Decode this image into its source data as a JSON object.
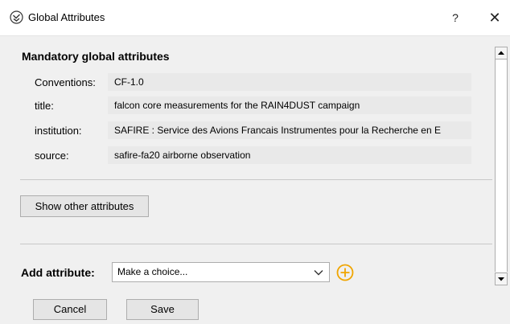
{
  "window": {
    "title": "Global Attributes",
    "help": "?",
    "close": "✕"
  },
  "mandatory": {
    "heading": "Mandatory global attributes",
    "rows": [
      {
        "label": "Conventions:",
        "value": "CF-1.0"
      },
      {
        "label": "title:",
        "value": "falcon core measurements for the RAIN4DUST campaign"
      },
      {
        "label": "institution:",
        "value": "SAFIRE : Service des Avions Francais Instrumentes pour la Recherche en E"
      },
      {
        "label": "source:",
        "value": "safire-fa20 airborne observation"
      }
    ]
  },
  "show_other_label": "Show other attributes",
  "add_attribute": {
    "label": "Add attribute:",
    "selected": "Make a choice..."
  },
  "footer": {
    "cancel_label": "Cancel",
    "save_label": "Save"
  },
  "colors": {
    "accent_plus": "#f0a500",
    "field_bg": "#e9e9e9"
  }
}
